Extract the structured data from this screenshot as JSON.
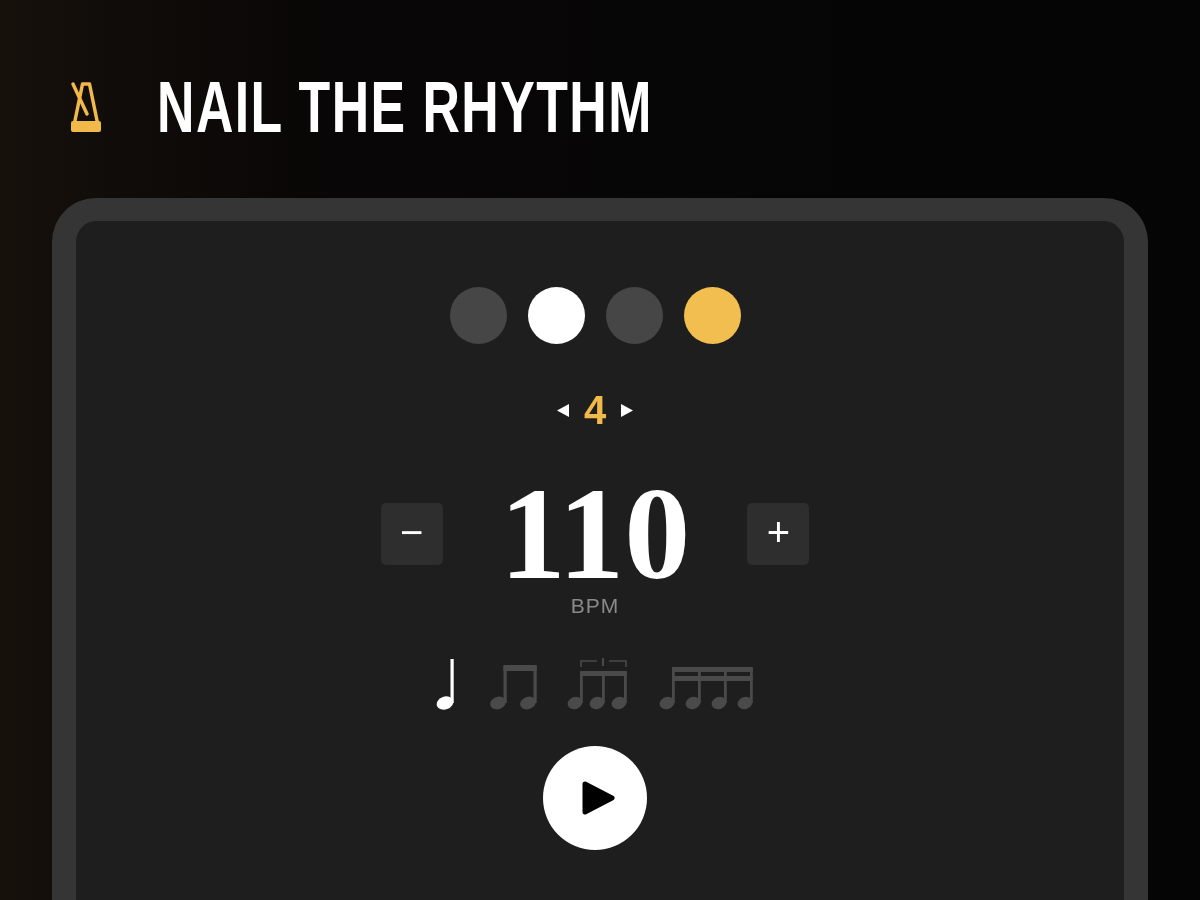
{
  "header": {
    "title": "NAIL THE RHYTHM"
  },
  "beat_dots": [
    {
      "color": "#464646"
    },
    {
      "color": "#ffffff"
    },
    {
      "color": "#464646"
    },
    {
      "color": "#f2be4f"
    }
  ],
  "beats_per_bar": {
    "value": "4"
  },
  "tempo": {
    "decrease": "−",
    "value": "110",
    "increase": "+",
    "unit": "BPM"
  },
  "subdivisions": [
    {
      "kind": "quarter",
      "selected": true
    },
    {
      "kind": "eighth",
      "selected": false
    },
    {
      "kind": "triplet",
      "selected": false
    },
    {
      "kind": "sixteenth",
      "selected": false
    }
  ]
}
